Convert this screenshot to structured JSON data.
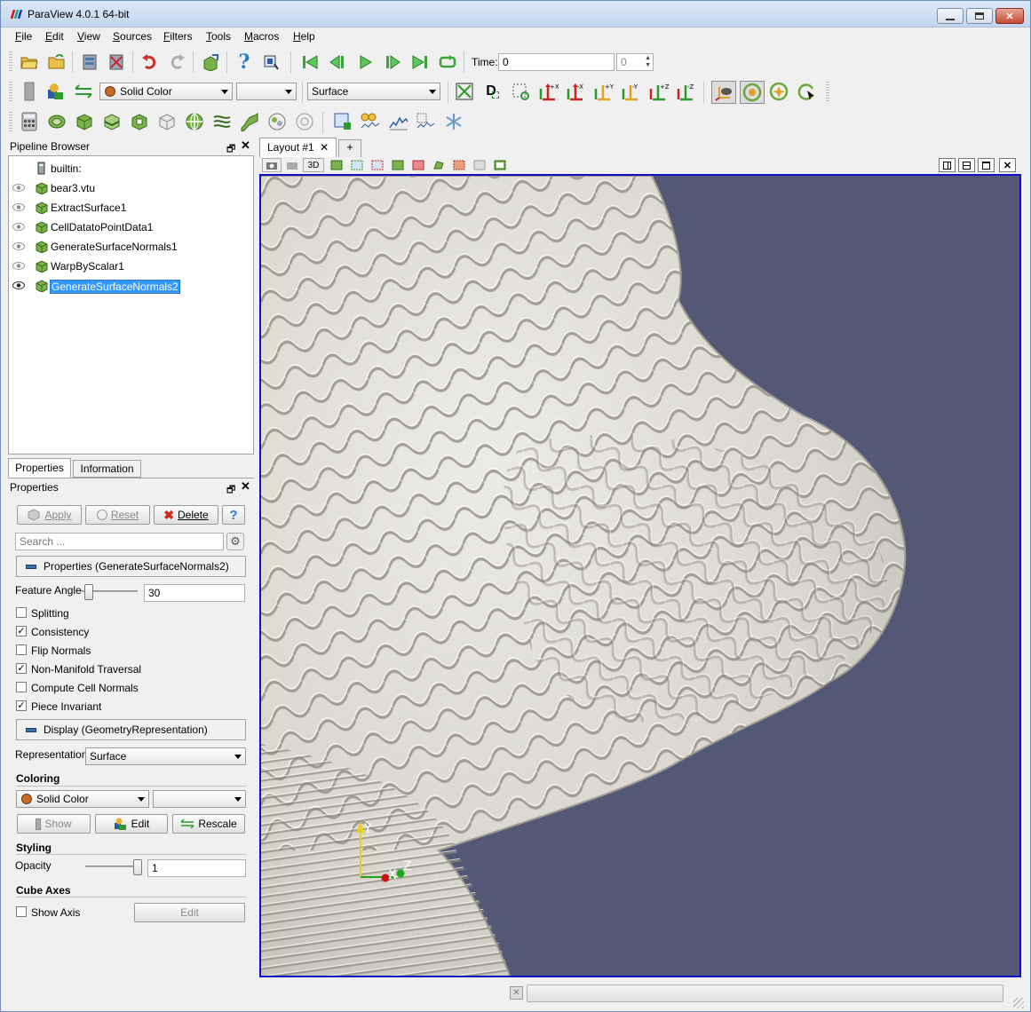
{
  "window": {
    "title": "ParaView 4.0.1 64-bit",
    "controls": [
      "minimize",
      "restore",
      "close"
    ]
  },
  "menu": [
    {
      "label": "File",
      "key": "F",
      "rest": "ile"
    },
    {
      "label": "Edit",
      "key": "E",
      "rest": "dit"
    },
    {
      "label": "View",
      "key": "V",
      "rest": "iew"
    },
    {
      "label": "Sources",
      "key": "S",
      "rest": "ources"
    },
    {
      "label": "Filters",
      "key": "F",
      "rest": "ilters"
    },
    {
      "label": "Tools",
      "key": "T",
      "rest": "ools"
    },
    {
      "label": "Macros",
      "key": "M",
      "rest": "acros"
    },
    {
      "label": "Help",
      "key": "H",
      "rest": "elp"
    }
  ],
  "time": {
    "label": "Time:",
    "value": "0",
    "index": "0"
  },
  "toolbar2": {
    "color_combo": "Solid Color",
    "component_combo": "",
    "representation_combo": "Surface"
  },
  "pipeline": {
    "title": "Pipeline Browser",
    "root": "builtin:",
    "items": [
      {
        "label": "bear3.vtu",
        "visible": true,
        "selected": false
      },
      {
        "label": "ExtractSurface1",
        "visible": true,
        "selected": false
      },
      {
        "label": "CellDatatoPointData1",
        "visible": true,
        "selected": false
      },
      {
        "label": "GenerateSurfaceNormals1",
        "visible": true,
        "selected": false
      },
      {
        "label": "WarpByScalar1",
        "visible": true,
        "selected": false
      },
      {
        "label": "GenerateSurfaceNormals2",
        "visible": true,
        "selected": true
      }
    ]
  },
  "tabs": {
    "properties": "Properties",
    "information": "Information"
  },
  "properties": {
    "title": "Properties",
    "apply": "Apply",
    "reset": "Reset",
    "delete": "Delete",
    "help": "?",
    "search_placeholder": "Search ...",
    "section_filter": "Properties (GenerateSurfaceNormals2)",
    "feature_angle_label": "Feature Angle",
    "feature_angle_value": "30",
    "feature_angle_fraction": 0.08,
    "checks": [
      {
        "label": "Splitting",
        "checked": false
      },
      {
        "label": "Consistency",
        "checked": true
      },
      {
        "label": "Flip Normals",
        "checked": false
      },
      {
        "label": "Non-Manifold Traversal",
        "checked": true
      },
      {
        "label": "Compute Cell Normals",
        "checked": false
      },
      {
        "label": "Piece Invariant",
        "checked": true
      }
    ],
    "section_display": "Display (GeometryRepresentation)",
    "representation_label": "Representation",
    "representation_value": "Surface",
    "coloring_header": "Coloring",
    "coloring_value": "Solid Color",
    "coloring_component": "",
    "show": "Show",
    "edit": "Edit",
    "rescale": "Rescale",
    "styling_header": "Styling",
    "opacity_label": "Opacity",
    "opacity_value": "1",
    "opacity_fraction": 1.0,
    "cube_axes_header": "Cube Axes",
    "show_axis": "Show Axis",
    "show_axis_checked": false,
    "cube_edit": "Edit"
  },
  "layout": {
    "tab_label": "Layout #1",
    "add_tab": "+",
    "view_3d_button": "3D",
    "background": "#545877"
  },
  "axes": {
    "x": "X",
    "y": "Y",
    "z": "Z"
  },
  "colors": {
    "selection": "#3399ff",
    "active_view_border": "#1010c8",
    "surface": "#e6e2d6"
  }
}
